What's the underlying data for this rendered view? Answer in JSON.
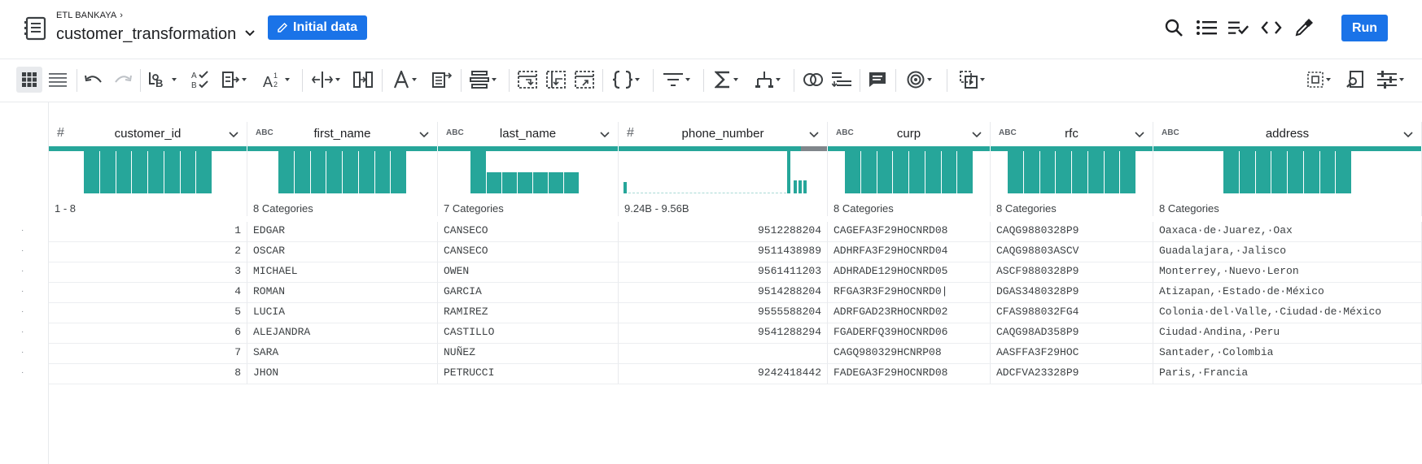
{
  "header": {
    "breadcrumb": "ETL BANKAYA",
    "title": "customer_transformation",
    "version_button": "Initial data",
    "run_button": "Run"
  },
  "columns": [
    {
      "type_label": "#",
      "name": "customer_id",
      "summary": "1 - 8"
    },
    {
      "type_label": "ABC",
      "name": "first_name",
      "summary": "8 Categories"
    },
    {
      "type_label": "ABC",
      "name": "last_name",
      "summary": "7 Categories"
    },
    {
      "type_label": "#",
      "name": "phone_number",
      "summary": "9.24B - 9.56B"
    },
    {
      "type_label": "ABC",
      "name": "curp",
      "summary": "8 Categories"
    },
    {
      "type_label": "ABC",
      "name": "rfc",
      "summary": "8 Categories"
    },
    {
      "type_label": "ABC",
      "name": "address",
      "summary": "8 Categories"
    }
  ],
  "rows": [
    {
      "customer_id": "1",
      "first_name": "EDGAR",
      "last_name": "CANSECO",
      "phone_number": "9512288204",
      "curp": "CAGEFA3F29HOCNRD08",
      "rfc": "CAQG9880328P9",
      "address": "Oaxaca·de·Juarez,·Oax"
    },
    {
      "customer_id": "2",
      "first_name": "OSCAR",
      "last_name": "CANSECO",
      "phone_number": "9511438989",
      "curp": "ADHRFA3F29HOCNRD04",
      "rfc": "CAQG98803ASCV",
      "address": "Guadalajara,·Jalisco"
    },
    {
      "customer_id": "3",
      "first_name": "MICHAEL",
      "last_name": "OWEN",
      "phone_number": "9561411203",
      "curp": "ADHRADE129HOCNRD05",
      "rfc": "ASCF9880328P9",
      "address": "Monterrey,·Nuevo·Leron"
    },
    {
      "customer_id": "4",
      "first_name": "ROMAN",
      "last_name": "GARCIA",
      "phone_number": "9514288204",
      "curp": "RFGA3R3F29HOCNRD0|",
      "rfc": "DGAS3480328P9",
      "address": "Atizapan,·Estado·de·México"
    },
    {
      "customer_id": "5",
      "first_name": "LUCIA",
      "last_name": "RAMIREZ",
      "phone_number": "9555588204",
      "curp": "ADRFGAD23RHOCNRD02",
      "rfc": "CFAS988032FG4",
      "address": "Colonia·del·Valle,·Ciudad·de·México"
    },
    {
      "customer_id": "6",
      "first_name": "ALEJANDRA",
      "last_name": "CASTILLO",
      "phone_number": "9541288294",
      "curp": "FGADERFQ39HOCNRD06",
      "rfc": "CAQG98AD358P9",
      "address": "Ciudad·Andina,·Peru"
    },
    {
      "customer_id": "7",
      "first_name": "SARA",
      "last_name": "NUÑEZ",
      "phone_number": "",
      "curp": "CAGQ980329HCNRP08",
      "rfc": "AASFFA3F29HOC",
      "address": "Santader,·Colombia"
    },
    {
      "customer_id": "8",
      "first_name": "JHON",
      "last_name": "PETRUCCI",
      "phone_number": "9242418442",
      "curp": "FADEGA3F29HOCNRD08",
      "rfc": "ADCFVA23328P9",
      "address": "Paris,·Francia"
    }
  ],
  "row_marker": "·",
  "colors": {
    "accent": "#1a73e8",
    "quality_valid": "#26a69a",
    "quality_missing": "#80868b"
  }
}
